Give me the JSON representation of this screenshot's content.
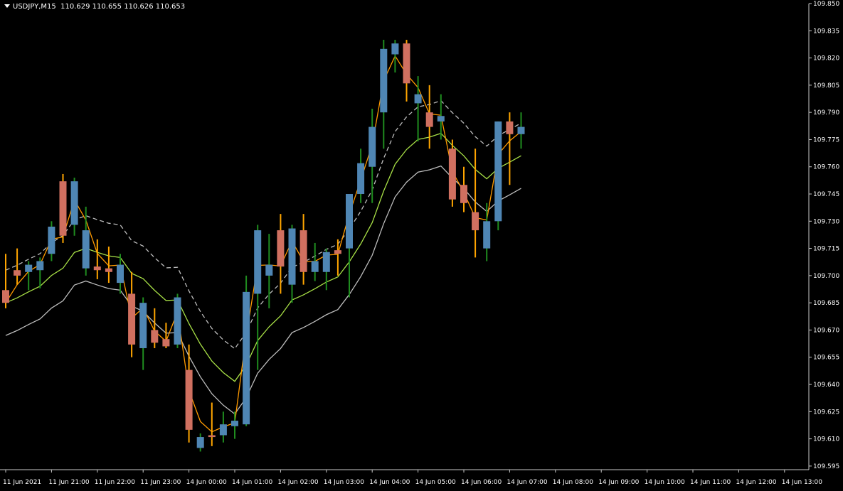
{
  "header": {
    "symbol": "USDJPY,M15",
    "ohlc": "110.629 110.655 110.626 110.653"
  },
  "colors": {
    "background": "#000000",
    "axis": "#c8c8c8",
    "bull_body": "#4f86b4",
    "bear_body": "#d07060",
    "wick_green": "#1f8c1f",
    "wick_orange": "#ffa500",
    "ma_fast": "#ff9a00",
    "ma_mid_up": "#a8e046",
    "ma_mid_down": "#e020e0",
    "envelope": "#bdbdbd",
    "zigzag": "#ffc8d0"
  },
  "chart_data": {
    "type": "candlestick",
    "title": "",
    "xlabel": "",
    "ylabel": "",
    "ylim": [
      109.593,
      109.85
    ],
    "y_ticks": [
      "109.850",
      "109.835",
      "109.820",
      "109.805",
      "109.790",
      "109.775",
      "109.760",
      "109.745",
      "109.730",
      "109.715",
      "109.700",
      "109.685",
      "109.670",
      "109.655",
      "109.640",
      "109.625",
      "109.610",
      "109.595"
    ],
    "x_ticks": [
      {
        "i": 0,
        "label": "11 Jun 2021"
      },
      {
        "i": 4,
        "label": "11 Jun 21:00"
      },
      {
        "i": 8,
        "label": "11 Jun 22:00"
      },
      {
        "i": 12,
        "label": "11 Jun 23:00"
      },
      {
        "i": 16,
        "label": "14 Jun 00:00"
      },
      {
        "i": 20,
        "label": "14 Jun 01:00"
      },
      {
        "i": 24,
        "label": "14 Jun 02:00"
      },
      {
        "i": 28,
        "label": "14 Jun 03:00"
      },
      {
        "i": 32,
        "label": "14 Jun 04:00"
      },
      {
        "i": 36,
        "label": "14 Jun 05:00"
      },
      {
        "i": 40,
        "label": "14 Jun 06:00"
      },
      {
        "i": 44,
        "label": "14 Jun 07:00"
      },
      {
        "i": 48,
        "label": "14 Jun 08:00"
      },
      {
        "i": 52,
        "label": "14 Jun 09:00"
      },
      {
        "i": 56,
        "label": "14 Jun 10:00"
      },
      {
        "i": 60,
        "label": "14 Jun 11:00"
      },
      {
        "i": 64,
        "label": "14 Jun 12:00"
      },
      {
        "i": 68,
        "label": "14 Jun 13:00"
      }
    ],
    "candles": [
      {
        "o": 109.692,
        "h": 109.712,
        "l": 109.682,
        "c": 109.685
      },
      {
        "o": 109.703,
        "h": 109.715,
        "l": 109.695,
        "c": 109.7
      },
      {
        "o": 109.702,
        "h": 109.708,
        "l": 109.692,
        "c": 109.706
      },
      {
        "o": 109.703,
        "h": 109.71,
        "l": 109.693,
        "c": 109.708
      },
      {
        "o": 109.712,
        "h": 109.73,
        "l": 109.708,
        "c": 109.727
      },
      {
        "o": 109.752,
        "h": 109.756,
        "l": 109.718,
        "c": 109.722
      },
      {
        "o": 109.728,
        "h": 109.754,
        "l": 109.722,
        "c": 109.752
      },
      {
        "o": 109.704,
        "h": 109.738,
        "l": 109.7,
        "c": 109.725
      },
      {
        "o": 109.705,
        "h": 109.72,
        "l": 109.698,
        "c": 109.703
      },
      {
        "o": 109.704,
        "h": 109.716,
        "l": 109.696,
        "c": 109.702
      },
      {
        "o": 109.696,
        "h": 109.712,
        "l": 109.69,
        "c": 109.706
      },
      {
        "o": 109.69,
        "h": 109.702,
        "l": 109.655,
        "c": 109.662
      },
      {
        "o": 109.66,
        "h": 109.688,
        "l": 109.648,
        "c": 109.685
      },
      {
        "o": 109.67,
        "h": 109.682,
        "l": 109.66,
        "c": 109.663
      },
      {
        "o": 109.665,
        "h": 109.674,
        "l": 109.66,
        "c": 109.661
      },
      {
        "o": 109.662,
        "h": 109.69,
        "l": 109.66,
        "c": 109.688
      },
      {
        "o": 109.648,
        "h": 109.662,
        "l": 109.608,
        "c": 109.615
      },
      {
        "o": 109.605,
        "h": 109.613,
        "l": 109.603,
        "c": 109.611
      },
      {
        "o": 109.612,
        "h": 109.63,
        "l": 109.606,
        "c": 109.611
      },
      {
        "o": 109.612,
        "h": 109.625,
        "l": 109.608,
        "c": 109.618
      },
      {
        "o": 109.617,
        "h": 109.625,
        "l": 109.61,
        "c": 109.62
      },
      {
        "o": 109.618,
        "h": 109.7,
        "l": 109.617,
        "c": 109.691
      },
      {
        "o": 109.69,
        "h": 109.728,
        "l": 109.648,
        "c": 109.725
      },
      {
        "o": 109.7,
        "h": 109.723,
        "l": 109.682,
        "c": 109.706
      },
      {
        "o": 109.725,
        "h": 109.734,
        "l": 109.69,
        "c": 109.705
      },
      {
        "o": 109.695,
        "h": 109.728,
        "l": 109.685,
        "c": 109.726
      },
      {
        "o": 109.725,
        "h": 109.734,
        "l": 109.695,
        "c": 109.702
      },
      {
        "o": 109.702,
        "h": 109.718,
        "l": 109.697,
        "c": 109.708
      },
      {
        "o": 109.702,
        "h": 109.715,
        "l": 109.692,
        "c": 109.713
      },
      {
        "o": 109.714,
        "h": 109.72,
        "l": 109.7,
        "c": 109.712
      },
      {
        "o": 109.715,
        "h": 109.73,
        "l": 109.688,
        "c": 109.745
      },
      {
        "o": 109.745,
        "h": 109.77,
        "l": 109.74,
        "c": 109.762
      },
      {
        "o": 109.76,
        "h": 109.792,
        "l": 109.74,
        "c": 109.782
      },
      {
        "o": 109.79,
        "h": 109.83,
        "l": 109.77,
        "c": 109.825
      },
      {
        "o": 109.822,
        "h": 109.83,
        "l": 109.812,
        "c": 109.828
      },
      {
        "o": 109.828,
        "h": 109.83,
        "l": 109.796,
        "c": 109.806
      },
      {
        "o": 109.795,
        "h": 109.81,
        "l": 109.774,
        "c": 109.8
      },
      {
        "o": 109.79,
        "h": 109.805,
        "l": 109.77,
        "c": 109.782
      },
      {
        "o": 109.785,
        "h": 109.8,
        "l": 109.775,
        "c": 109.788
      },
      {
        "o": 109.77,
        "h": 109.775,
        "l": 109.738,
        "c": 109.742
      },
      {
        "o": 109.75,
        "h": 109.76,
        "l": 109.735,
        "c": 109.74
      },
      {
        "o": 109.735,
        "h": 109.77,
        "l": 109.71,
        "c": 109.725
      },
      {
        "o": 109.715,
        "h": 109.74,
        "l": 109.708,
        "c": 109.73
      },
      {
        "o": 109.73,
        "h": 109.785,
        "l": 109.725,
        "c": 109.785
      },
      {
        "o": 109.785,
        "h": 109.79,
        "l": 109.75,
        "c": 109.778
      },
      {
        "o": 109.778,
        "h": 109.79,
        "l": 109.77,
        "c": 109.782
      }
    ],
    "zigzag_labels": []
  }
}
